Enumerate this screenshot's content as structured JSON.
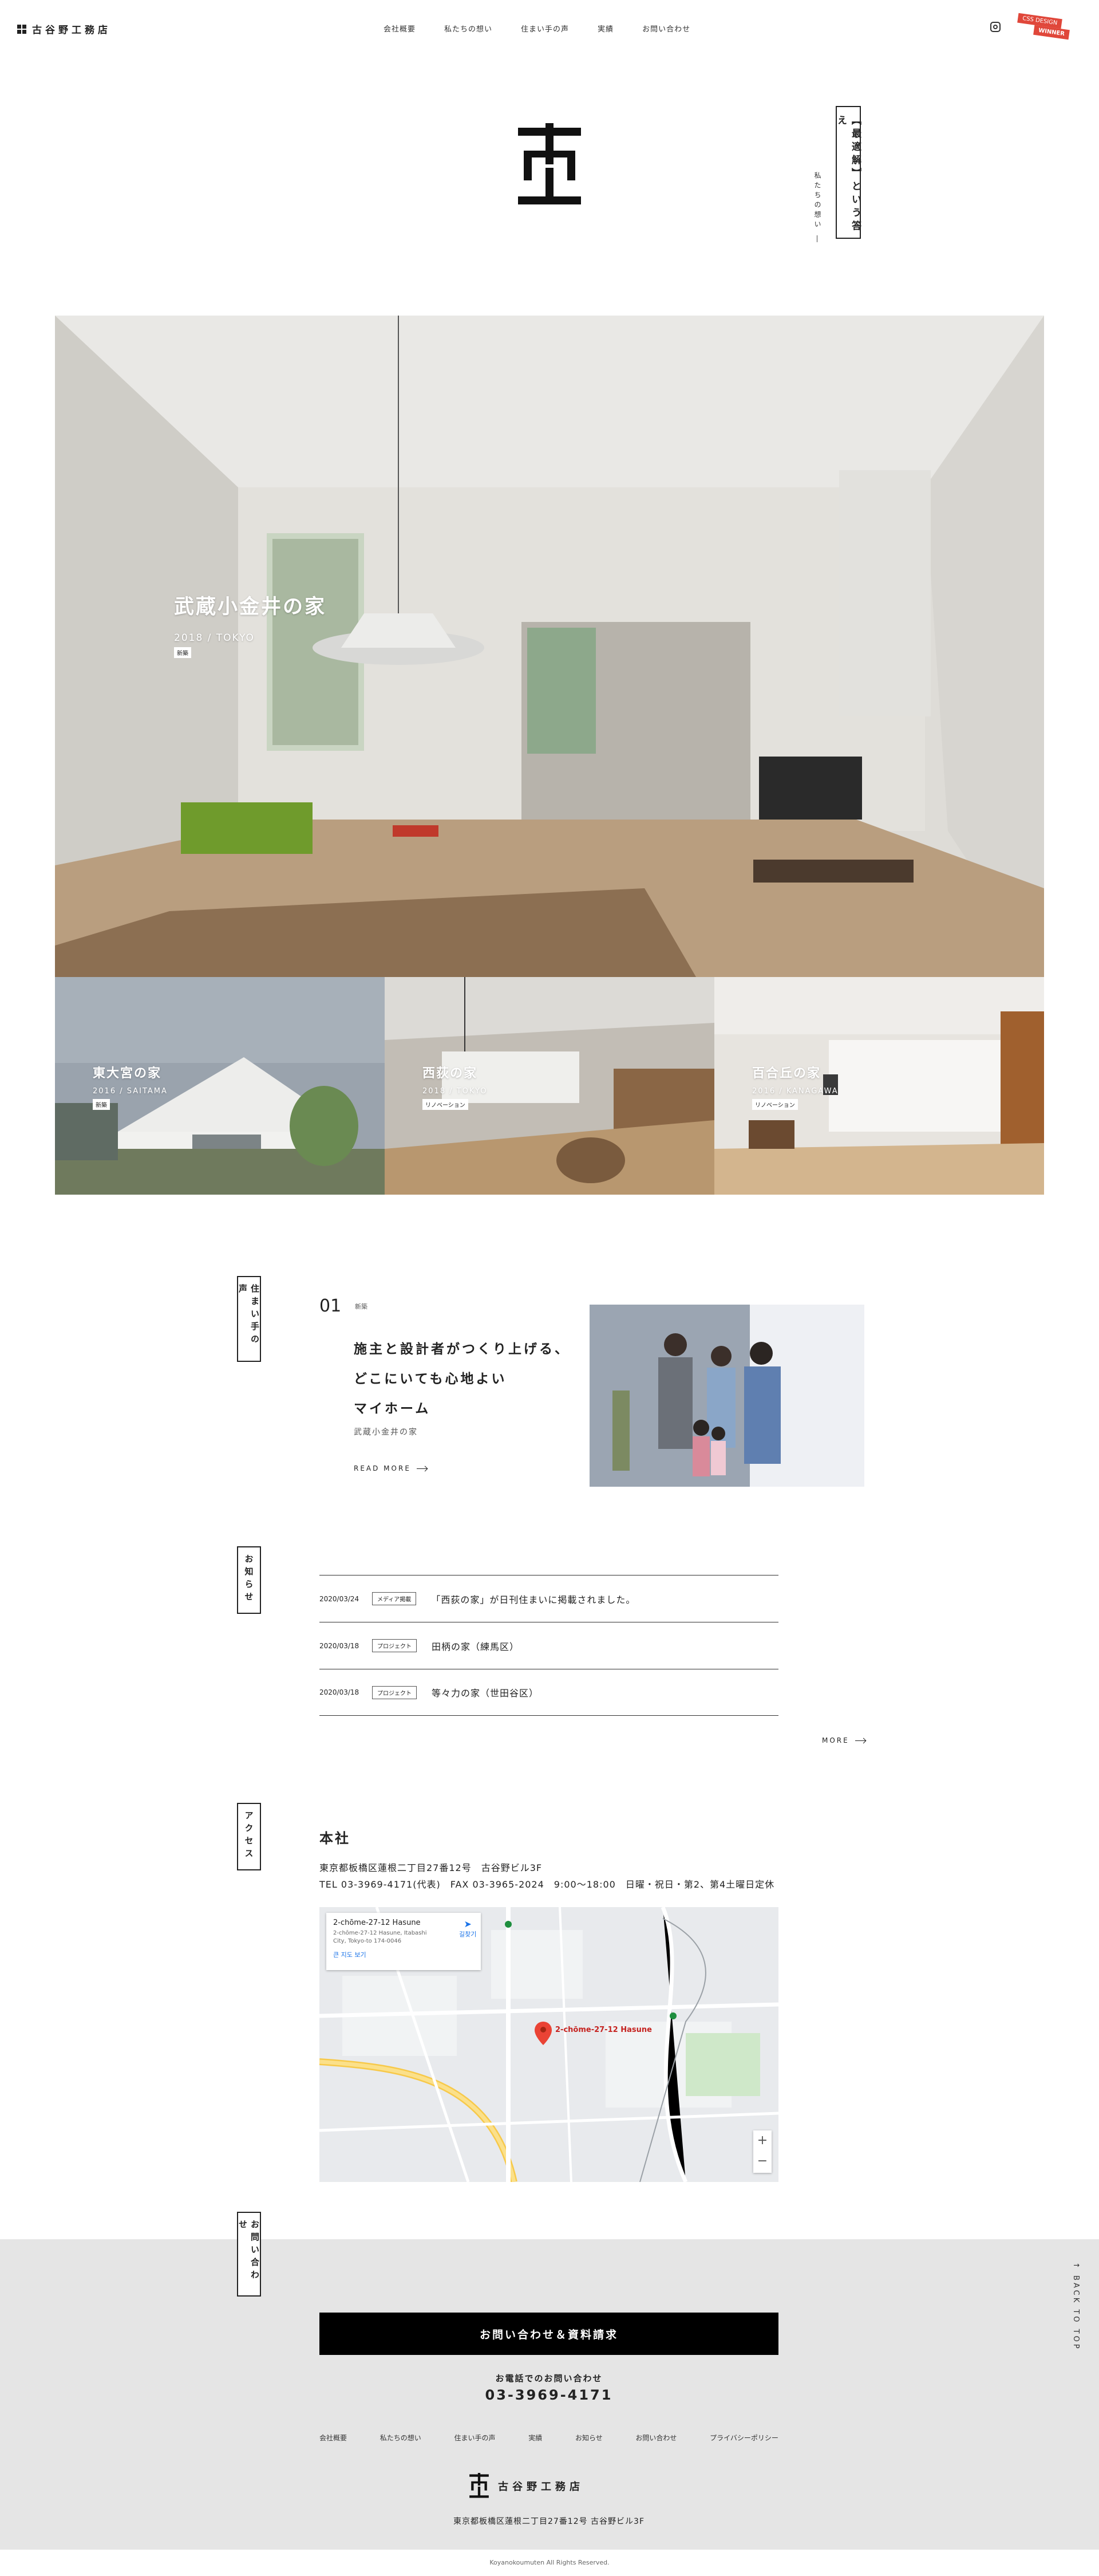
{
  "header": {
    "logo_text": "古谷野工務店",
    "nav": [
      "会社概要",
      "私たちの想い",
      "住まい手の声",
      "実績",
      "お問い合わせ"
    ],
    "ribbon_top": "CSS DESIGN",
    "ribbon_bottom": "WINNER"
  },
  "hero": {
    "catch": "【最適解】という答え",
    "catch_sub": "私たちの想い ―"
  },
  "works": {
    "main": {
      "title": "武蔵小金井の家",
      "year": "2018 / TOKYO",
      "badge": "新築"
    },
    "tiles": [
      {
        "title": "東大宮の家",
        "year": "2016 / SAITAMA",
        "badge": "新築"
      },
      {
        "title": "西荻の家",
        "year": "2018 / TOKYO",
        "badge": "リノベーション"
      },
      {
        "title": "百合丘の家",
        "year": "2016 / KANAGAWA",
        "badge": "リノベーション"
      }
    ]
  },
  "voice": {
    "label": "住まい手の声",
    "number": "01",
    "tag": "新築",
    "title_lines": [
      "施主と設計者がつくり上げる、",
      "どこにいても心地よい",
      "マイホーム"
    ],
    "name": "武蔵小金井の家",
    "more": "READ MORE"
  },
  "news": {
    "label": "お知らせ",
    "items": [
      {
        "date": "2020/03/24",
        "category": "メディア掲載",
        "title": "「西荻の家」が日刊住まいに掲載されました。"
      },
      {
        "date": "2020/03/18",
        "category": "プロジェクト",
        "title": "田柄の家（練馬区）"
      },
      {
        "date": "2020/03/18",
        "category": "プロジェクト",
        "title": "等々力の家（世田谷区）"
      }
    ],
    "more": "MORE"
  },
  "access": {
    "label": "アクセス",
    "heading": "本社",
    "address": "東京都板橋区蓮根二丁目27番12号　古谷野ビル3F",
    "tel_line": "TEL 03-3969-4171(代表)　FAX 03-3965-2024　9:00～18:00　日曜・祝日・第2、第4土曜日定休",
    "map": {
      "card_title": "2-chōme-27-12 Hasune",
      "card_sub": "2-chōme-27-12 Hasune, Itabashi City, Tokyo-to 174-0046",
      "card_link": "큰 지도 보기",
      "directions": "길찾기",
      "pin_label": "2-chōme-27-12 Hasune",
      "zoom_in": "+",
      "zoom_out": "−"
    }
  },
  "contact": {
    "label": "お問い合わせ",
    "button": "お問い合わせ＆資料請求",
    "tel_label": "お電話でのお問い合わせ",
    "tel": "03-3969-4171"
  },
  "footer": {
    "nav": [
      "会社概要",
      "私たちの想い",
      "住まい手の声",
      "実績",
      "お知らせ",
      "お問い合わせ",
      "プライバシーポリシー"
    ],
    "logo_text": "古谷野工務店",
    "address": "東京都板橋区蓮根二丁目27番12号 古谷野ビル3F",
    "copyright": "Koyanokoumuten All Rights Reserved.",
    "back_to_top": "BACK TO TOP"
  }
}
